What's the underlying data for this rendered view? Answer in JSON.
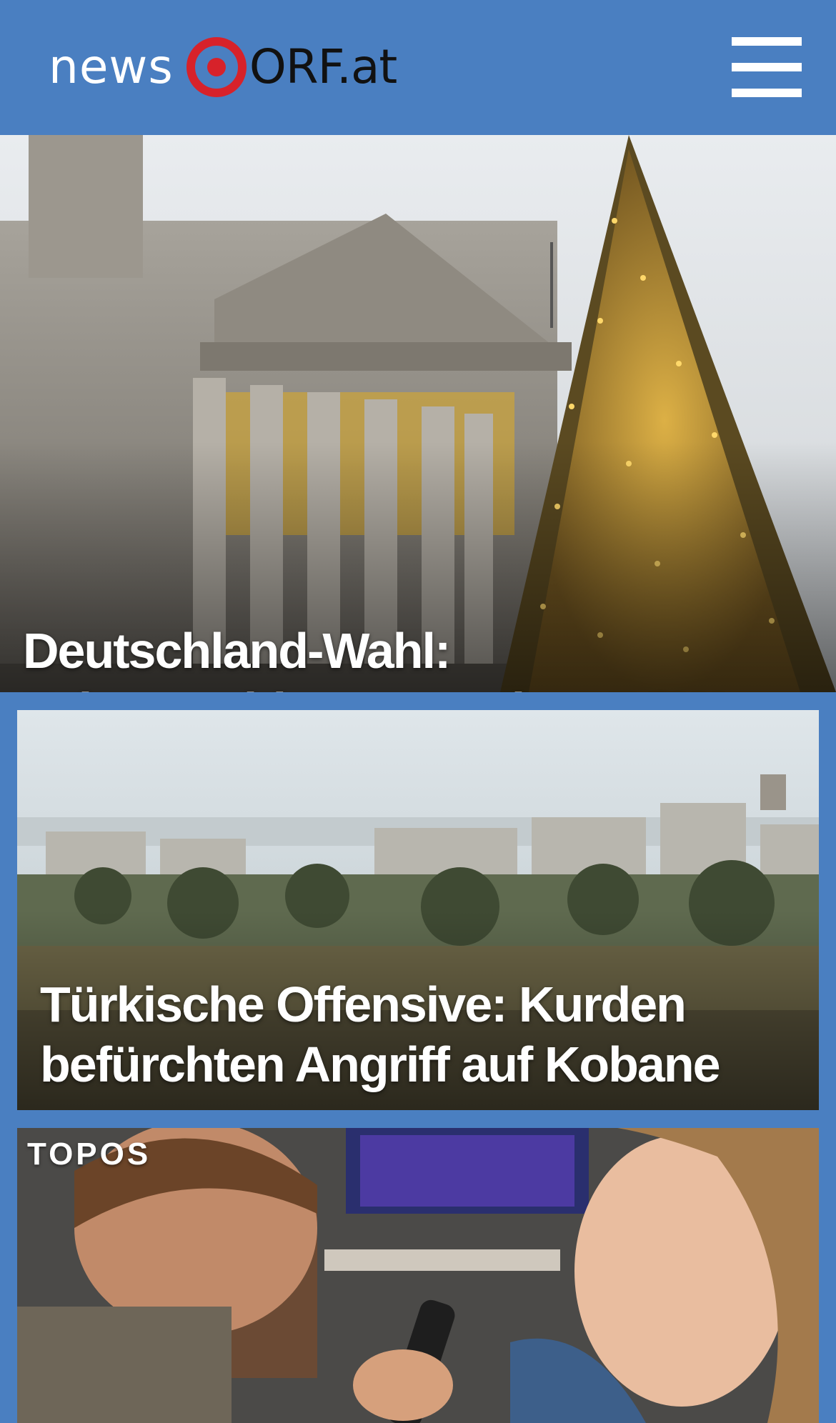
{
  "header": {
    "logo_news": "news",
    "logo_orf": "ORF.at",
    "menu_icon": "hamburger-menu-icon",
    "background_color": "#4a7fc1"
  },
  "articles": [
    {
      "headline": "Deutschland-Wahl: Fairnessabkommen ohne BSW und AfD",
      "image": "reichstag-building-christmas-tree"
    },
    {
      "headline": "Türkische Offensive: Kurden befürchten Angriff auf Kobane",
      "image": "town-skyline-landscape"
    },
    {
      "category": "TOPOS",
      "image": "couple-watching-tv-remote"
    }
  ],
  "colors": {
    "brand_blue": "#4a7fc1",
    "logo_red": "#d7222a"
  }
}
